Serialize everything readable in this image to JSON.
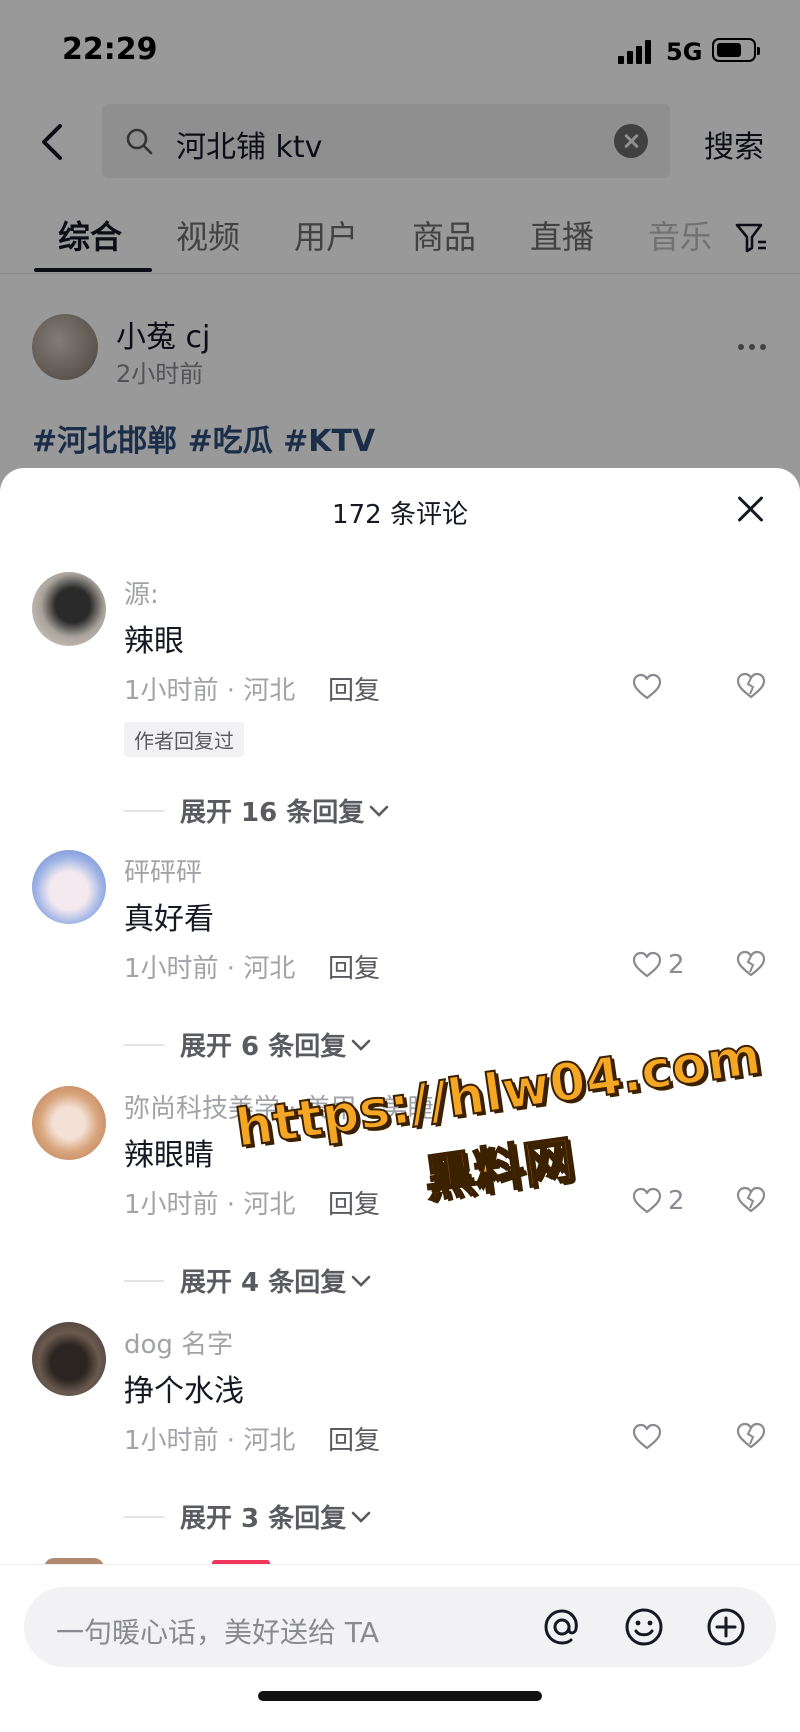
{
  "status_bar": {
    "time": "22:29",
    "network": "5G"
  },
  "search": {
    "query": "河北铺 ktv",
    "submit_label": "搜索"
  },
  "tabs": [
    {
      "label": "综合"
    },
    {
      "label": "视频"
    },
    {
      "label": "用户"
    },
    {
      "label": "商品"
    },
    {
      "label": "直播"
    },
    {
      "label": "音乐"
    }
  ],
  "post": {
    "author": "小菟 cj",
    "time": "2小时前",
    "hashtags": "#河北邯郸 #吃瓜 #KTV"
  },
  "comments_sheet": {
    "title": "172 条评论",
    "comments": [
      {
        "name": "源:",
        "text": "辣眼",
        "meta": "1小时前 · 河北",
        "reply": "回复",
        "likes": "",
        "badge": "作者回复过",
        "expand": "展开 16 条回复"
      },
      {
        "name": "砰砰砰",
        "text": "真好看",
        "meta": "1小时前 · 河北",
        "reply": "回复",
        "likes": "2",
        "expand": "展开 6 条回复"
      },
      {
        "name": "弥尚科技美学 · 美甲 · 美睫",
        "text": "辣眼睛",
        "meta": "1小时前 · 河北",
        "reply": "回复",
        "likes": "2",
        "expand": "展开 4 条回复"
      },
      {
        "name": "dog 名字",
        "text": "挣个水浅",
        "meta": "1小时前 · 河北",
        "reply": "回复",
        "likes": "",
        "expand": "展开 3 条回复"
      }
    ],
    "input_placeholder": "一句暖心话，美好送给 TA"
  },
  "watermark": {
    "line1": "https://hlw04.com",
    "line2": "黑料网"
  },
  "colors": {
    "hashtag": "#2d4d7a",
    "watermark": "#f5a623",
    "tag_red": "#f2365b"
  }
}
